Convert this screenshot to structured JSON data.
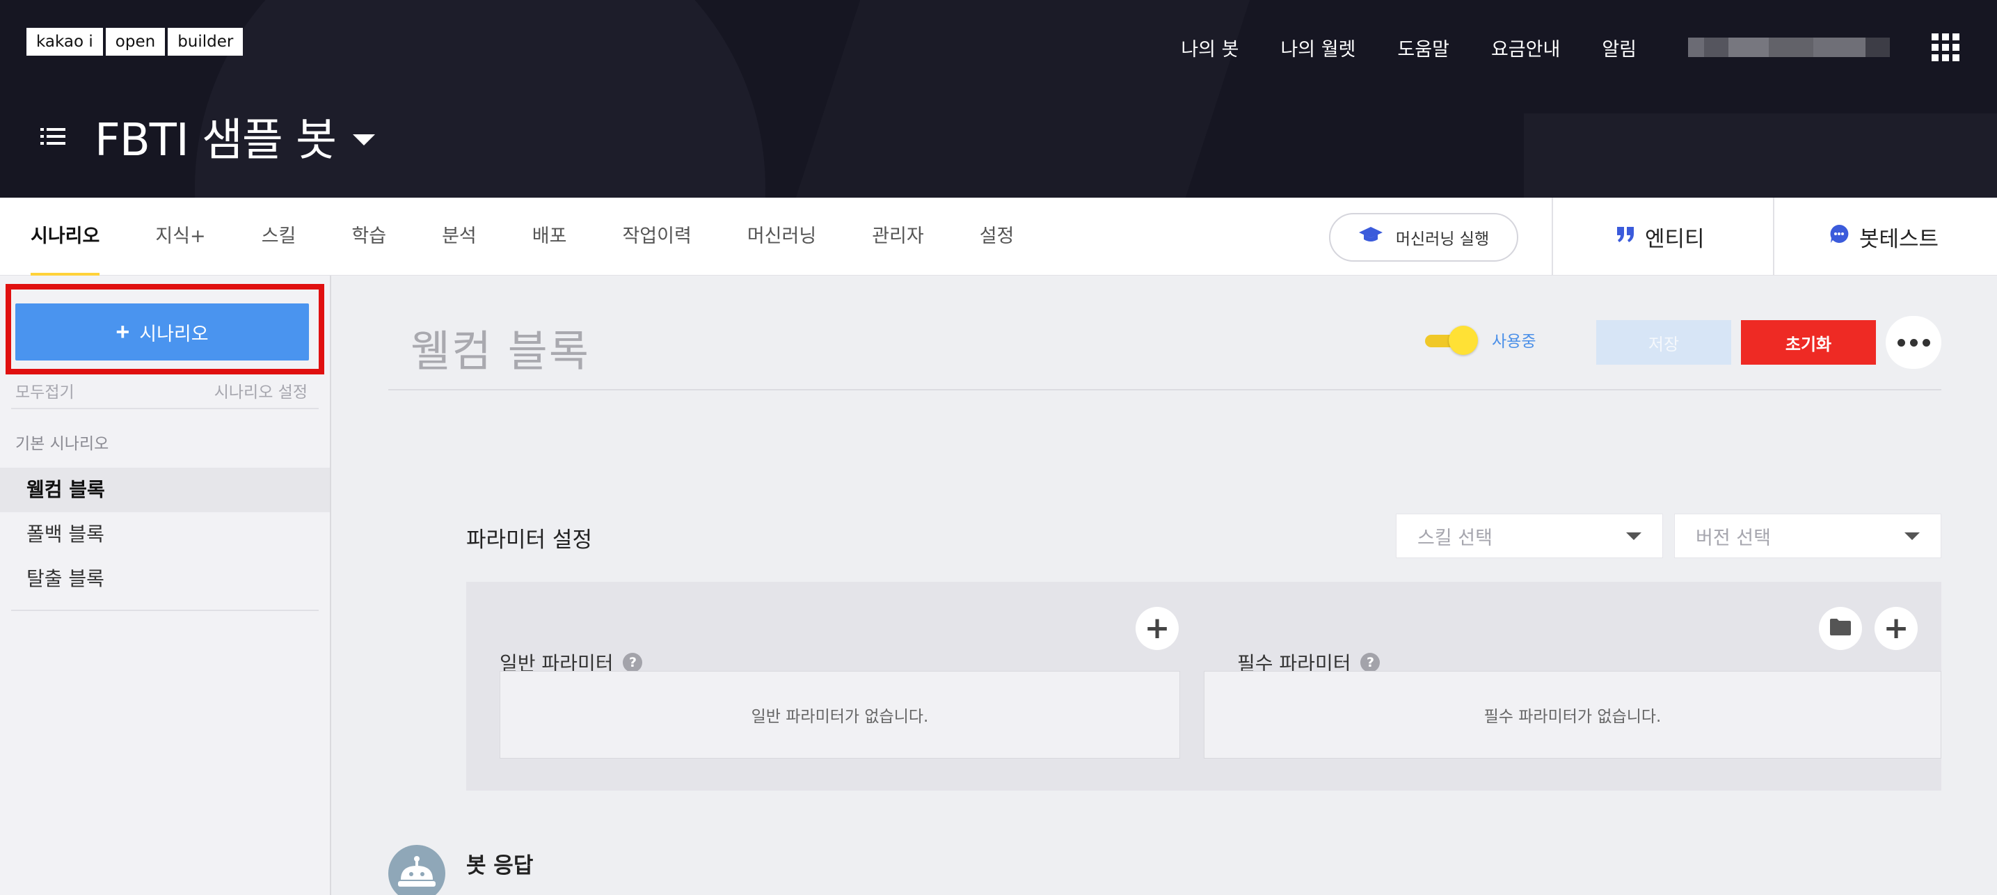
{
  "logo": [
    "kakao i",
    "open",
    "builder"
  ],
  "topnav": {
    "items": [
      "나의 봇",
      "나의 월렛",
      "도움말",
      "요금안내",
      "알림"
    ]
  },
  "bot": {
    "title": "FBTI 샘플 봇"
  },
  "tabs": [
    "시나리오",
    "지식+",
    "스킬",
    "학습",
    "분석",
    "배포",
    "작업이력",
    "머신러닝",
    "관리자",
    "설정"
  ],
  "tabbar": {
    "ml_run": "머신러닝 실행",
    "entity": "엔티티",
    "bottest": "봇테스트"
  },
  "sidebar": {
    "add_scenario": "시나리오",
    "collapse_all": "모두접기",
    "scenario_settings": "시나리오 설정",
    "group_label": "기본 시나리오",
    "items": [
      "웰컴 블록",
      "폴백 블록",
      "탈출 블록"
    ]
  },
  "main": {
    "block_title": "웰컴 블록",
    "toggle_label": "사용중",
    "save": "저장",
    "reset": "초기화",
    "param_title": "파라미터 설정",
    "skill_select": "스킬 선택",
    "version_select": "버전 선택",
    "general_params": "일반 파라미터",
    "required_params": "필수 파라미터",
    "general_empty": "일반 파라미터가 없습니다.",
    "required_empty": "필수 파라미터가 없습니다.",
    "bot_response": "봇 응답"
  },
  "colors": {
    "header_bg": "#161622",
    "accent_yellow": "#ffd23a",
    "primary_blue": "#4a94ef",
    "danger_red": "#ee2a24",
    "highlight_outline": "#e01010"
  }
}
